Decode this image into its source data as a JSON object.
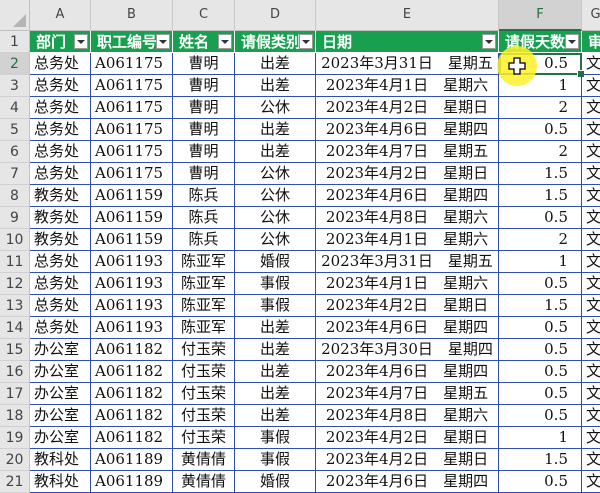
{
  "columns": [
    "A",
    "B",
    "C",
    "D",
    "E",
    "F",
    "G"
  ],
  "header": [
    "部门",
    "职工编号",
    "姓名",
    "请假类别",
    "日期",
    "请假天数",
    "审"
  ],
  "rows": [
    [
      "总务处",
      "A061175",
      "曹明",
      "出差",
      "2023年3月31日　星期五",
      "0.5",
      "文"
    ],
    [
      "总务处",
      "A061175",
      "曹明",
      "出差",
      "2023年4月1日　星期六",
      "1",
      "文"
    ],
    [
      "总务处",
      "A061175",
      "曹明",
      "公休",
      "2023年4月2日　星期日",
      "2",
      "文"
    ],
    [
      "总务处",
      "A061175",
      "曹明",
      "出差",
      "2023年4月6日　星期四",
      "0.5",
      "文"
    ],
    [
      "总务处",
      "A061175",
      "曹明",
      "出差",
      "2023年4月7日　星期五",
      "2",
      "文"
    ],
    [
      "总务处",
      "A061175",
      "曹明",
      "公休",
      "2023年4月2日　星期日",
      "1.5",
      "文"
    ],
    [
      "教务处",
      "A061159",
      "陈兵",
      "公休",
      "2023年4月6日　星期四",
      "1.5",
      "文"
    ],
    [
      "教务处",
      "A061159",
      "陈兵",
      "公休",
      "2023年4月8日　星期六",
      "0.5",
      "文"
    ],
    [
      "教务处",
      "A061159",
      "陈兵",
      "公休",
      "2023年4月1日　星期六",
      "2",
      "文"
    ],
    [
      "总务处",
      "A061193",
      "陈亚军",
      "婚假",
      "2023年3月31日　星期五",
      "1",
      "文"
    ],
    [
      "总务处",
      "A061193",
      "陈亚军",
      "事假",
      "2023年4月1日　星期六",
      "0.5",
      "文"
    ],
    [
      "总务处",
      "A061193",
      "陈亚军",
      "事假",
      "2023年4月2日　星期日",
      "1.5",
      "文"
    ],
    [
      "总务处",
      "A061193",
      "陈亚军",
      "出差",
      "2023年4月6日　星期四",
      "0.5",
      "文"
    ],
    [
      "办公室",
      "A061182",
      "付玉荣",
      "出差",
      "2023年3月30日　星期四",
      "0.5",
      "文"
    ],
    [
      "办公室",
      "A061182",
      "付玉荣",
      "出差",
      "2023年4月6日　星期四",
      "0.5",
      "文"
    ],
    [
      "办公室",
      "A061182",
      "付玉荣",
      "出差",
      "2023年4月7日　星期五",
      "0.5",
      "文"
    ],
    [
      "办公室",
      "A061182",
      "付玉荣",
      "出差",
      "2023年4月8日　星期六",
      "0.5",
      "文"
    ],
    [
      "办公室",
      "A061182",
      "付玉荣",
      "事假",
      "2023年4月2日　星期日",
      "1",
      "文"
    ],
    [
      "教科处",
      "A061189",
      "黄倩倩",
      "事假",
      "2023年4月2日　星期日",
      "1.5",
      "文"
    ],
    [
      "教科处",
      "A061189",
      "黄倩倩",
      "婚假",
      "2023年4月6日　星期四",
      "0.5",
      "文"
    ]
  ],
  "row_numbers": [
    "1",
    "2",
    "3",
    "4",
    "5",
    "6",
    "7",
    "8",
    "9",
    "10",
    "11",
    "12",
    "13",
    "14",
    "15",
    "16",
    "17",
    "18",
    "19",
    "20",
    "21"
  ],
  "selection": {
    "cell": "F2",
    "column": "F",
    "row": "2"
  },
  "colors": {
    "header_fill": "#18a050",
    "grid_border": "#2f4fae",
    "selection": "#217346"
  }
}
